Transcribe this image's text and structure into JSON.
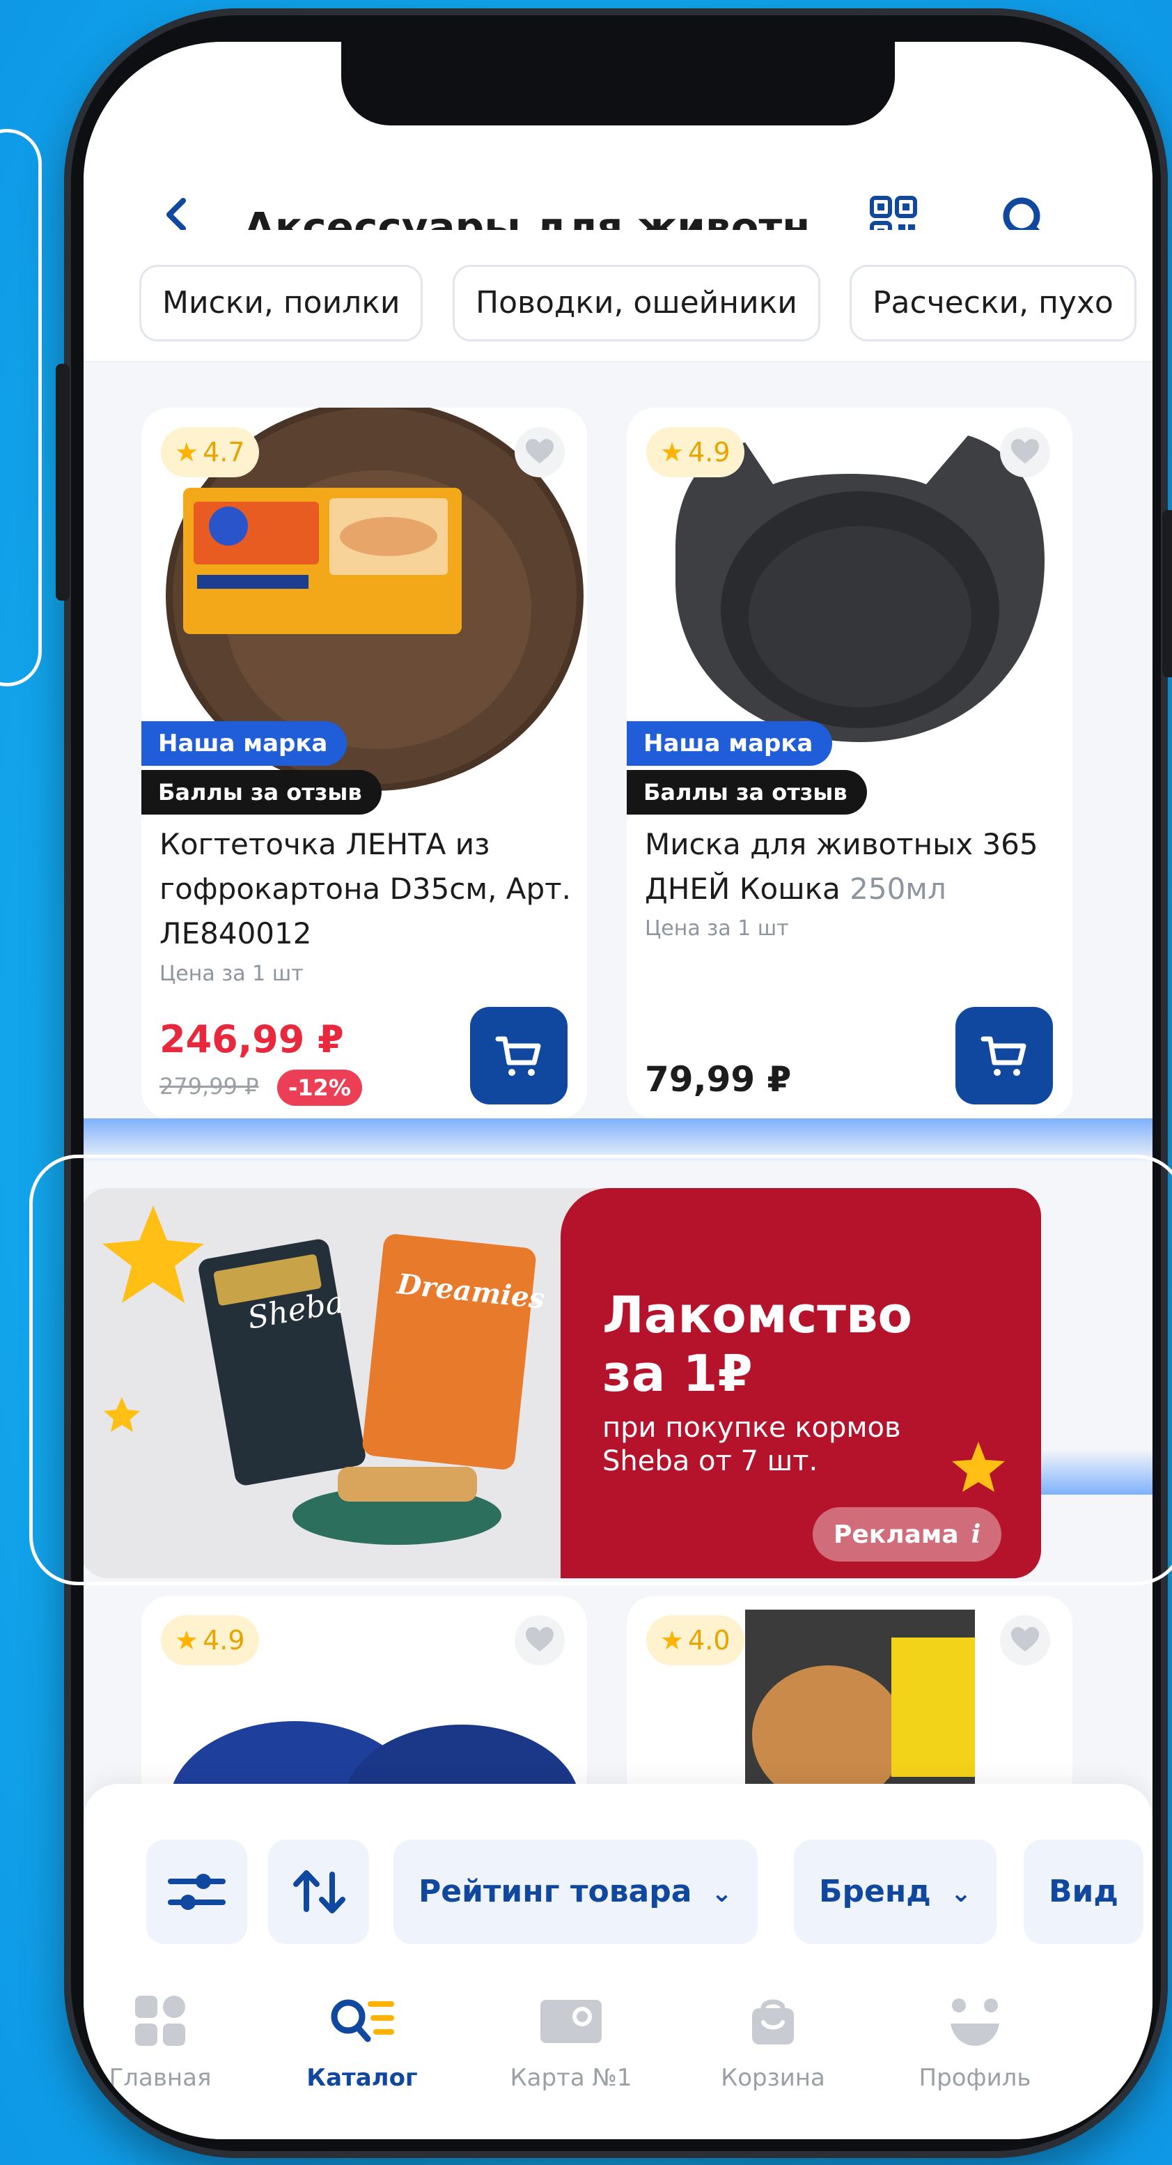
{
  "header": {
    "title": "Аксессуары для животн..."
  },
  "chips": [
    "Миски, поилки",
    "Поводки, ошейники",
    "Расчески, пухо"
  ],
  "products": [
    {
      "rating": "4.7",
      "badge_brand": "Наша марка",
      "badge_review": "Баллы за отзыв",
      "name": "Когтеточка ЛЕНТА из гофрокартона D35см, Арт. ЛЕ840012",
      "unit": "Цена за 1 шт",
      "price": "246,99 ₽",
      "old_price": "279,99 ₽",
      "discount": "-12%"
    },
    {
      "rating": "4.9",
      "badge_brand": "Наша марка",
      "badge_review": "Баллы за отзыв",
      "name": "Миска для животных 365 ДНЕЙ Кошка",
      "volume": "250мл",
      "unit": "Цена за 1 шт",
      "price": "79,99 ₽"
    },
    {
      "rating": "4.9"
    },
    {
      "rating": "4.0"
    }
  ],
  "banner": {
    "title_line1": "Лакомство",
    "title_line2": "за 1₽",
    "sub_line1": "при покупке кормов",
    "sub_line2": "Sheba от 7 шт.",
    "ad_label": "Реклама",
    "brand1": "Sheba",
    "brand2": "Dreamies"
  },
  "filters": [
    "Рейтинг товара",
    "Бренд",
    "Вид"
  ],
  "nav": {
    "items": [
      {
        "label": "Главная",
        "active": false
      },
      {
        "label": "Каталог",
        "active": true
      },
      {
        "label": "Карта №1",
        "active": false
      },
      {
        "label": "Корзина",
        "active": false
      },
      {
        "label": "Профиль",
        "active": false
      }
    ]
  },
  "colors": {
    "accent_blue": "#10479f",
    "price_red": "#e8283c",
    "promo_red": "#b5122b",
    "background": "#15aef0"
  }
}
